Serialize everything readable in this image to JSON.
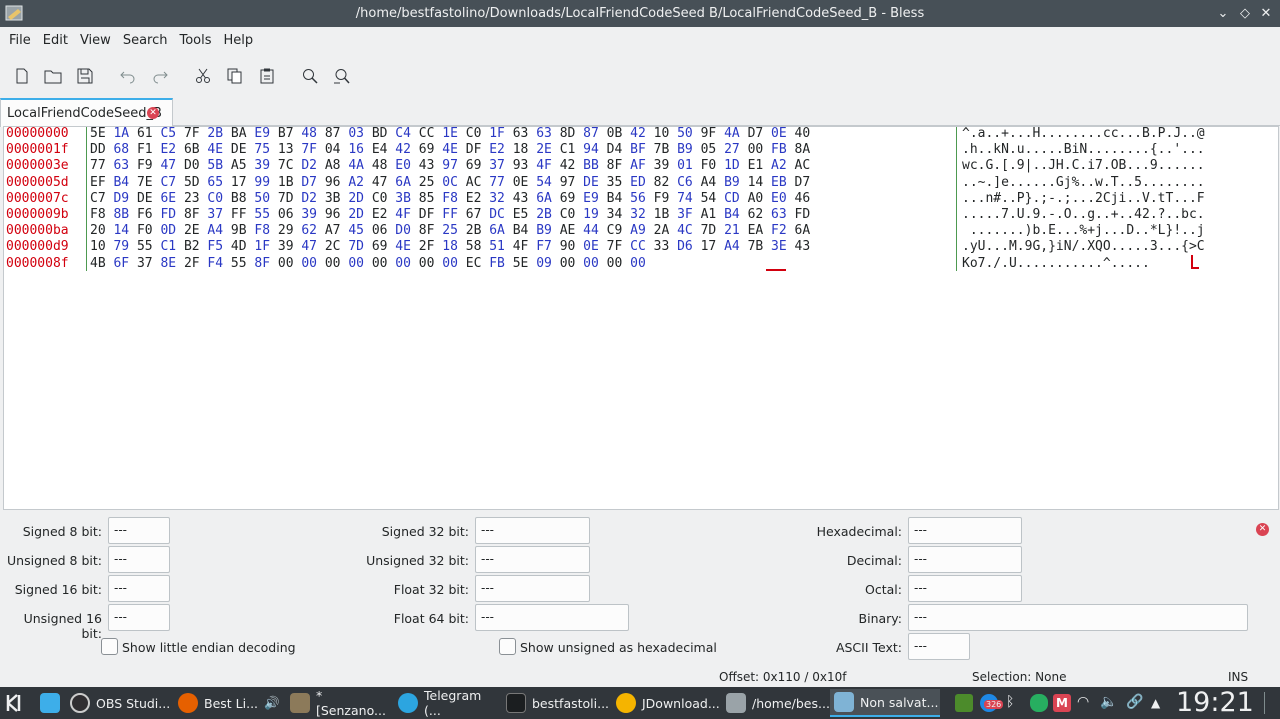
{
  "window": {
    "title": "/home/bestfastolino/Downloads/LocalFriendCodeSeed B/LocalFriendCodeSeed_B - Bless"
  },
  "menu": [
    "File",
    "Edit",
    "View",
    "Search",
    "Tools",
    "Help"
  ],
  "toolbar": [
    "new-file-icon",
    "open-folder-icon",
    "save-icon",
    "undo-icon",
    "redo-icon",
    "cut-icon",
    "copy-icon",
    "paste-icon",
    "find-icon",
    "find-replace-icon"
  ],
  "tab": {
    "label": "LocalFriendCodeSeed_B"
  },
  "hex": {
    "offsets": [
      "00000000",
      "0000001f",
      "0000003e",
      "0000005d",
      "0000007c",
      "0000009b",
      "000000ba",
      "000000d9",
      "0000008f"
    ],
    "rows": [
      "5E 1A 61 C5 7F 2B BA E9 B7 48 87 03 BD C4 CC 1E C0 1F 63 63 8D 87 0B 42 10 50 9F 4A D7 0E 40",
      "DD 68 F1 E2 6B 4E DE 75 13 7F 04 16 E4 42 69 4E DF E2 18 2E C1 94 D4 BF 7B B9 05 27 00 FB 8A",
      "77 63 F9 47 D0 5B A5 39 7C D2 A8 4A 48 E0 43 97 69 37 93 4F 42 BB 8F AF 39 01 F0 1D E1 A2 AC",
      "EF B4 7E C7 5D 65 17 99 1B D7 96 A2 47 6A 25 0C AC 77 0E 54 97 DE 35 ED 82 C6 A4 B9 14 EB D7",
      "C7 D9 DE 6E 23 C0 B8 50 7D D2 3B 2D C0 3B 85 F8 E2 32 43 6A 69 E9 B4 56 F9 74 54 CD A0 E0 46",
      "F8 8B F6 FD 8F 37 FF 55 06 39 96 2D E2 4F DF FF 67 DC E5 2B C0 19 34 32 1B 3F A1 B4 62 63 FD",
      "20 14 F0 0D 2E A4 9B F8 29 62 A7 45 06 D0 8F 25 2B 6A B4 B9 AE 44 C9 A9 2A 4C 7D 21 EA F2 6A",
      "10 79 55 C1 B2 F5 4D 1F 39 47 2C 7D 69 4E 2F 18 58 51 4F F7 90 0E 7F CC 33 D6 17 A4 7B 3E 43",
      "4B 6F 37 8E 2F F4 55 8F 00 00 00 00 00 00 00 00 EC FB 5E 09 00 00 00 00"
    ],
    "ascii": [
      "^.a..+...H........cc...B.P.J..@",
      ".h..kN.u.....BiN........{..'...",
      "wc.G.[.9|..JH.C.i7.OB...9......",
      "..~.]e......Gj%..w.T..5........",
      "...n#..P}.;-.;...2Cji..V.tT...F",
      ".....7.U.9.-.O..g..+..42.?..bc.",
      " .......)b.E...%+j...D..*L}!..j",
      ".yU...M.9G,}iN/.XQO.....3...{>C",
      "Ko7./.U...........^....."
    ]
  },
  "fields": {
    "signed8": {
      "label": "Signed 8 bit:",
      "value": "---"
    },
    "unsigned8": {
      "label": "Unsigned 8 bit:",
      "value": "---"
    },
    "signed16": {
      "label": "Signed 16 bit:",
      "value": "---"
    },
    "unsigned16": {
      "label": "Unsigned 16 bit:",
      "value": "---"
    },
    "signed32": {
      "label": "Signed 32 bit:",
      "value": "---"
    },
    "unsigned32": {
      "label": "Unsigned 32 bit:",
      "value": "---"
    },
    "float32": {
      "label": "Float 32 bit:",
      "value": "---"
    },
    "float64": {
      "label": "Float 64 bit:",
      "value": "---"
    },
    "hexadecimal": {
      "label": "Hexadecimal:",
      "value": "---"
    },
    "decimal": {
      "label": "Decimal:",
      "value": "---"
    },
    "octal": {
      "label": "Octal:",
      "value": "---"
    },
    "binary": {
      "label": "Binary:",
      "value": "---"
    },
    "ascii": {
      "label": "ASCII Text:",
      "value": "---"
    }
  },
  "checkboxes": {
    "little_endian": "Show little endian decoding",
    "unsigned_hex": "Show unsigned as hexadecimal"
  },
  "status": {
    "offset": "Offset: 0x110 / 0x10f",
    "selection": "Selection: None",
    "mode": "INS"
  },
  "taskbar": {
    "tasks": [
      "OBS Studi...",
      "Best Li...",
      "*[Senzano...",
      "Telegram (...",
      "bestfastoli...",
      "JDownload...",
      "/home/bes...",
      "Non salvat..."
    ],
    "clock": "19:21",
    "badge": "326"
  },
  "colors": {
    "titlebar": "#475057",
    "offset_red": "#d2000e",
    "alt_byte_blue": "#2a38c4",
    "separator_green": "#4d9950",
    "taskbar": "#31363b"
  }
}
